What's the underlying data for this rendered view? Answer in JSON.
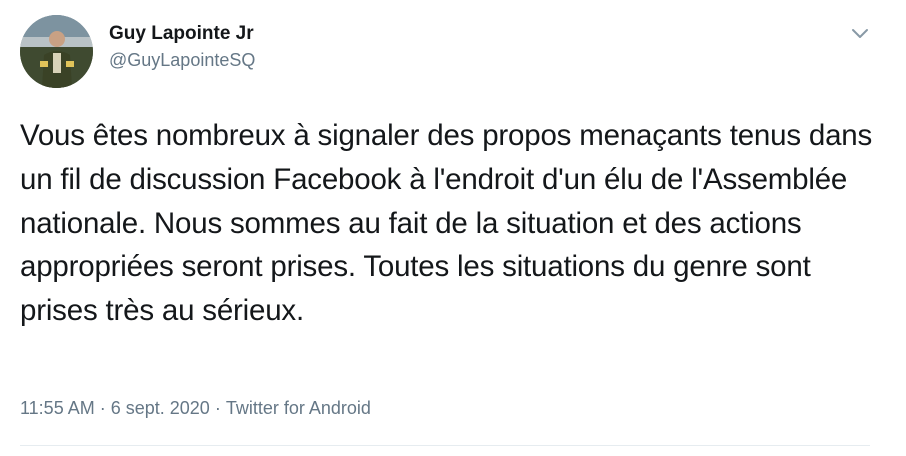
{
  "author": {
    "name": "Guy Lapointe Jr",
    "handle": "@GuyLapointeSQ",
    "avatar_icon": "profile-photo"
  },
  "tweet": {
    "text": "Vous êtes nombreux à signaler des propos menaçants tenus dans un fil de discussion Facebook à l'endroit d'un élu de l'Assemblée nationale. Nous sommes au fait de la situation et des actions appropriées seront prises. Toutes les situations du genre sont prises très au sérieux.",
    "time": "11:55 AM",
    "separator": " · ",
    "date": "6 sept. 2020",
    "source": "Twitter for Android"
  },
  "menu": {
    "caret_icon": "chevron-down-icon"
  },
  "colors": {
    "primary_text": "#14171a",
    "secondary_text": "#657786",
    "divider": "#e6ecf0"
  }
}
